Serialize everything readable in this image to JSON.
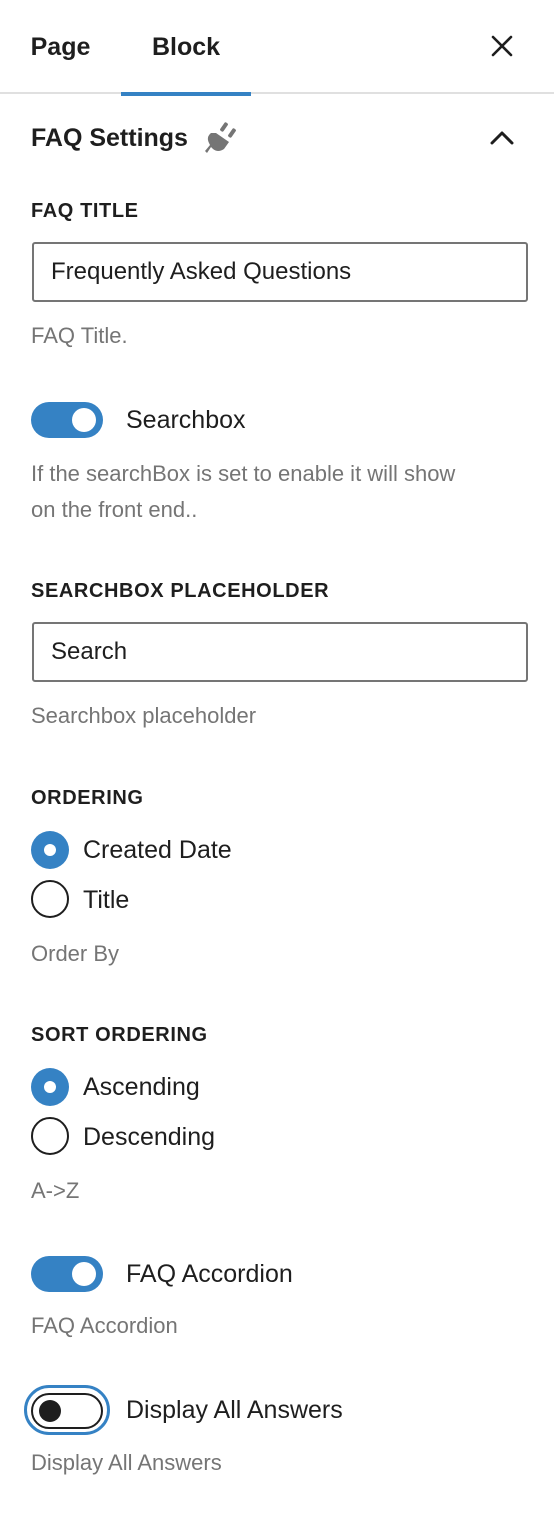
{
  "tabs": {
    "page": "Page",
    "block": "Block"
  },
  "panel": {
    "title": "FAQ Settings"
  },
  "faq_title": {
    "label": "FAQ TITLE",
    "value": "Frequently Asked Questions",
    "help": "FAQ Title."
  },
  "searchbox": {
    "label": "Searchbox",
    "enabled": true,
    "help_line1": "If the searchBox is set to enable it will show",
    "help_line2": "on the front end.."
  },
  "searchbox_placeholder": {
    "label": "SEARCHBOX PLACEHOLDER",
    "value": "Search",
    "help": "Searchbox placeholder"
  },
  "ordering": {
    "label": "ORDERING",
    "options": [
      "Created Date",
      "Title"
    ],
    "selected": "Created Date",
    "help": "Order By"
  },
  "sort_ordering": {
    "label": "SORT ORDERING",
    "options": [
      "Ascending",
      "Descending"
    ],
    "selected": "Ascending",
    "help": "A->Z"
  },
  "faq_accordion": {
    "label": "FAQ Accordion",
    "enabled": true,
    "help": "FAQ Accordion"
  },
  "display_all_answers": {
    "label": "Display All Answers",
    "enabled": false,
    "help": "Display All Answers"
  },
  "colors": {
    "accent": "#3582c4",
    "text": "#1e1e1e",
    "muted": "#757575"
  },
  "icons": {
    "close": "close-icon",
    "plugin": "plug-icon",
    "collapse": "chevron-up-icon"
  }
}
